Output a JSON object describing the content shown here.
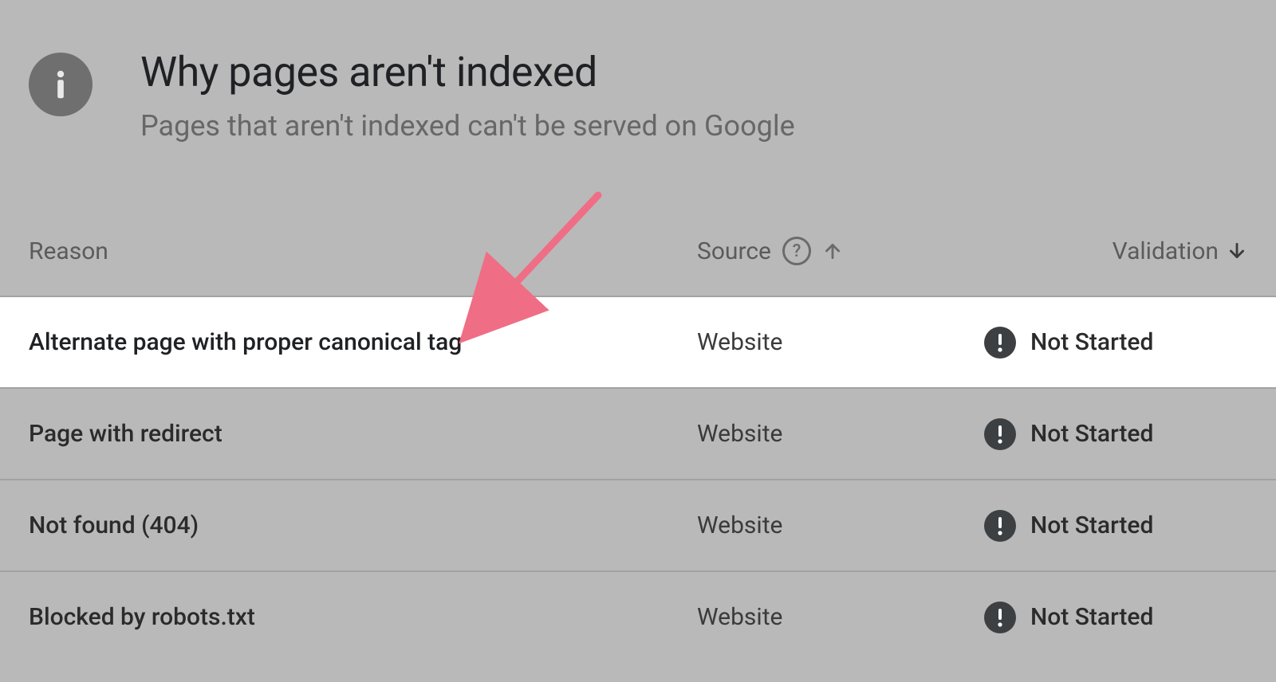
{
  "header": {
    "title": "Why pages aren't indexed",
    "subtitle": "Pages that aren't indexed can't be served on Google"
  },
  "columns": {
    "reason": "Reason",
    "source": "Source",
    "validation": "Validation"
  },
  "rows": [
    {
      "reason": "Alternate page with proper canonical tag",
      "source": "Website",
      "validation": "Not Started",
      "highlight": true
    },
    {
      "reason": "Page with redirect",
      "source": "Website",
      "validation": "Not Started",
      "highlight": false
    },
    {
      "reason": "Not found (404)",
      "source": "Website",
      "validation": "Not Started",
      "highlight": false
    },
    {
      "reason": "Blocked by robots.txt",
      "source": "Website",
      "validation": "Not Started",
      "highlight": false
    }
  ]
}
